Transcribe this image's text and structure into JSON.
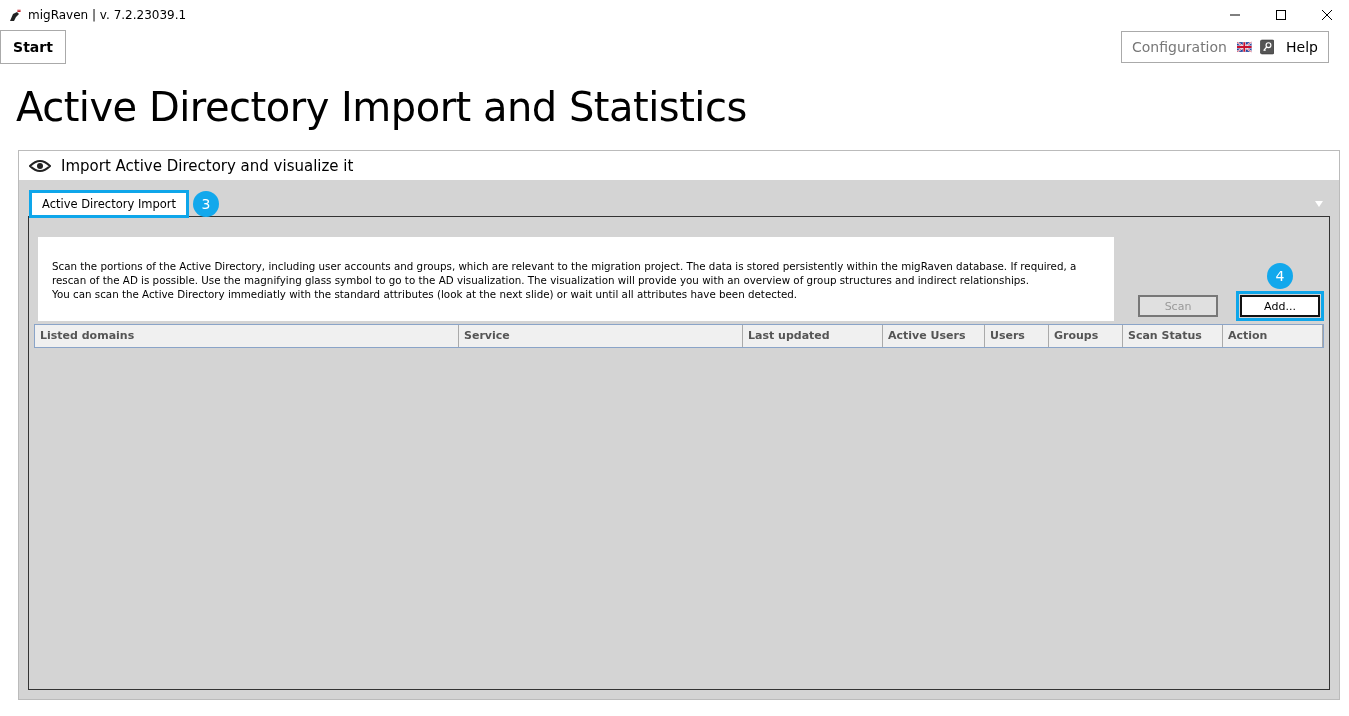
{
  "window": {
    "title": "migRaven | v. 7.2.23039.1"
  },
  "toolbar": {
    "start": "Start",
    "configuration": "Configuration",
    "help": "Help"
  },
  "heading": "Active Directory Import and Statistics",
  "panel": {
    "title": "Import Active Directory and visualize it",
    "tabs": [
      {
        "label": "Active Directory Import",
        "selected": true,
        "callout": "3"
      }
    ],
    "description": [
      "Scan the portions of the Active Directory, including user accounts and groups, which are relevant to the migration project. The data is stored persistently within the migRaven database. If required, a",
      "rescan of the AD is possible. Use the magnifying glass symbol to go to the AD visualization. The visualization will provide you with an overview of group structures and indirect relationships.",
      "You can scan the Active Directory immediatly with the standard attributes (look at the next slide) or wait until all attributes have been detected."
    ],
    "buttons": [
      {
        "label": "Scan",
        "disabled": true
      },
      {
        "label": "Add...",
        "disabled": false,
        "callout": "4"
      }
    ],
    "table": {
      "columns": [
        "Listed domains",
        "Service",
        "Last updated",
        "Active Users",
        "Users",
        "Groups",
        "Scan Status",
        "Action"
      ]
    }
  }
}
